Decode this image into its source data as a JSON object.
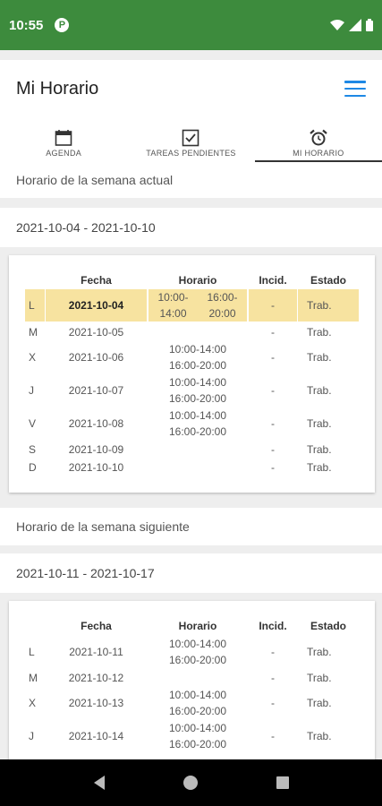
{
  "status": {
    "time": "10:55",
    "app_badge": "P"
  },
  "appbar": {
    "title": "Mi Horario"
  },
  "tabs": [
    {
      "label": "AGENDA",
      "icon": "calendar-icon"
    },
    {
      "label": "TAREAS PENDIENTES",
      "icon": "checkbox-icon"
    },
    {
      "label": "MI HORARIO",
      "icon": "alarm-clock-icon",
      "active": true
    }
  ],
  "current_week": {
    "header": "Horario de la semana actual",
    "range": "2021-10-04 - 2021-10-10",
    "columns": [
      "Fecha",
      "Horario",
      "Incid.",
      "Estado"
    ],
    "rows": [
      {
        "day": "L",
        "date": "2021-10-04",
        "h1": "10:00-14:00",
        "h2": "16:00-20:00",
        "inc": "-",
        "estado": "Trab.",
        "highlight": true
      },
      {
        "day": "M",
        "date": "2021-10-05",
        "h1": "",
        "h2": "",
        "inc": "-",
        "estado": "Trab."
      },
      {
        "day": "X",
        "date": "2021-10-06",
        "h1": "10:00-14:00",
        "h2": "16:00-20:00",
        "inc": "-",
        "estado": "Trab."
      },
      {
        "day": "J",
        "date": "2021-10-07",
        "h1": "10:00-14:00",
        "h2": "16:00-20:00",
        "inc": "-",
        "estado": "Trab."
      },
      {
        "day": "V",
        "date": "2021-10-08",
        "h1": "10:00-14:00",
        "h2": "16:00-20:00",
        "inc": "-",
        "estado": "Trab."
      },
      {
        "day": "S",
        "date": "2021-10-09",
        "h1": "",
        "h2": "",
        "inc": "-",
        "estado": "Trab."
      },
      {
        "day": "D",
        "date": "2021-10-10",
        "h1": "",
        "h2": "",
        "inc": "-",
        "estado": "Trab."
      }
    ]
  },
  "next_week": {
    "header": "Horario de la semana siguiente",
    "range": "2021-10-11 - 2021-10-17",
    "columns": [
      "Fecha",
      "Horario",
      "Incid.",
      "Estado"
    ],
    "rows": [
      {
        "day": "L",
        "date": "2021-10-11",
        "h1": "10:00-14:00",
        "h2": "16:00-20:00",
        "inc": "-",
        "estado": "Trab."
      },
      {
        "day": "M",
        "date": "2021-10-12",
        "h1": "",
        "h2": "",
        "inc": "-",
        "estado": "Trab."
      },
      {
        "day": "X",
        "date": "2021-10-13",
        "h1": "10:00-14:00",
        "h2": "16:00-20:00",
        "inc": "-",
        "estado": "Trab."
      },
      {
        "day": "J",
        "date": "2021-10-14",
        "h1": "10:00-14:00",
        "h2": "16:00-20:00",
        "inc": "-",
        "estado": "Trab."
      }
    ]
  },
  "colors": {
    "statusbar": "#3d8b3d",
    "accent": "#1e88e5",
    "highlight": "#f7e3a0"
  }
}
